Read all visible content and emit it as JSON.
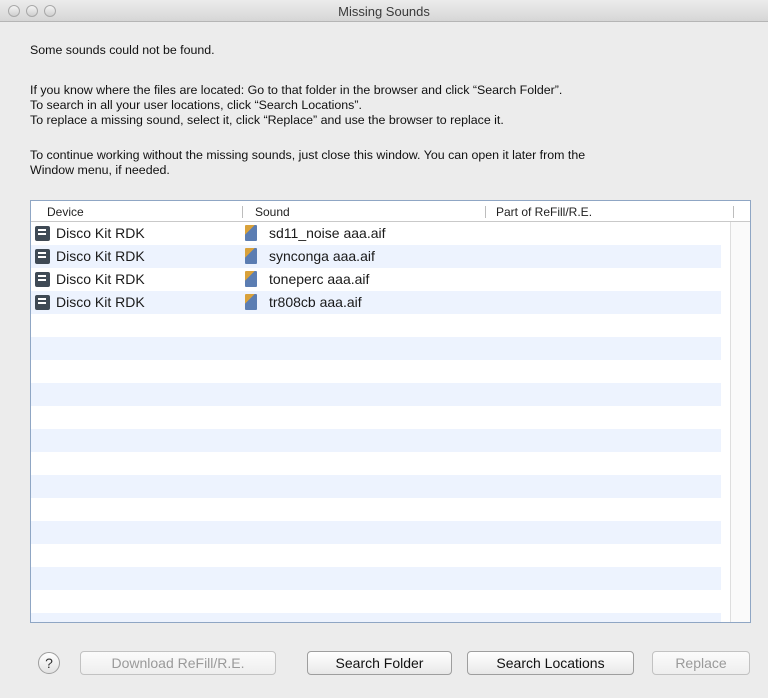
{
  "window": {
    "title": "Missing Sounds"
  },
  "message": {
    "intro": "Some sounds could not be found.",
    "line1": "If you know where the files are located: Go to that folder in the browser and click “Search Folder”.",
    "line2": "To search in all your user locations, click “Search Locations”.",
    "line3": "To replace a missing sound, select it, click “Replace” and use the browser to replace it.",
    "line4": "To continue working without the missing sounds, just close this window. You can open it later from the",
    "line5": "Window menu, if needed."
  },
  "table": {
    "headers": {
      "device": "Device",
      "sound": "Sound",
      "part": "Part of ReFill/R.E."
    },
    "rows": [
      {
        "device": "Disco Kit RDK",
        "sound": "sd11_noise aaa.aif",
        "part": ""
      },
      {
        "device": "Disco Kit RDK",
        "sound": "synconga aaa.aif",
        "part": ""
      },
      {
        "device": "Disco Kit RDK",
        "sound": "toneperc aaa.aif",
        "part": ""
      },
      {
        "device": "Disco Kit RDK",
        "sound": "tr808cb aaa.aif",
        "part": ""
      }
    ]
  },
  "buttons": {
    "help": "?",
    "download": "Download ReFill/R.E.",
    "search_folder": "Search Folder",
    "search_locations": "Search Locations",
    "replace": "Replace"
  }
}
